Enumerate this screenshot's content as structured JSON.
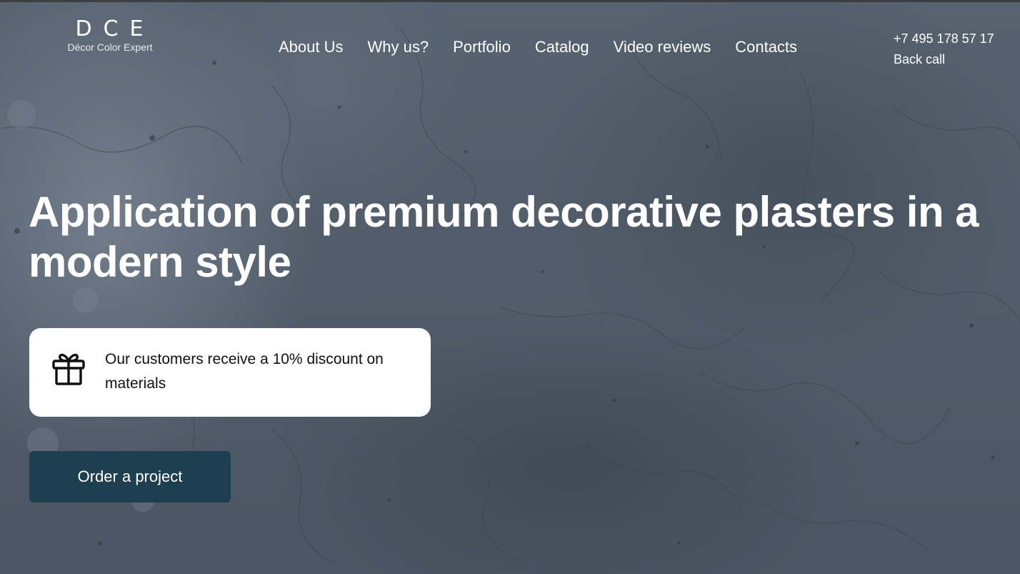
{
  "logo": {
    "mark": "DCE",
    "subtitle": "Décor Color Expert"
  },
  "nav": {
    "items": [
      {
        "label": "About Us"
      },
      {
        "label": "Why us?"
      },
      {
        "label": "Portfolio"
      },
      {
        "label": "Catalog"
      },
      {
        "label": "Video reviews"
      },
      {
        "label": "Contacts"
      }
    ]
  },
  "contact": {
    "phone": "+7 495 178 57 17",
    "back_call": "Back call"
  },
  "hero": {
    "headline": "Application of premium decorative plasters in a modern style",
    "offer": {
      "icon": "gift-icon",
      "text": "Our customers receive a 10% discount on materials"
    },
    "cta_label": "Order a project"
  },
  "colors": {
    "cta_background": "#1d3f50",
    "offer_background": "#ffffff",
    "text_light": "#ffffff",
    "background_concrete": "#5a6674"
  }
}
